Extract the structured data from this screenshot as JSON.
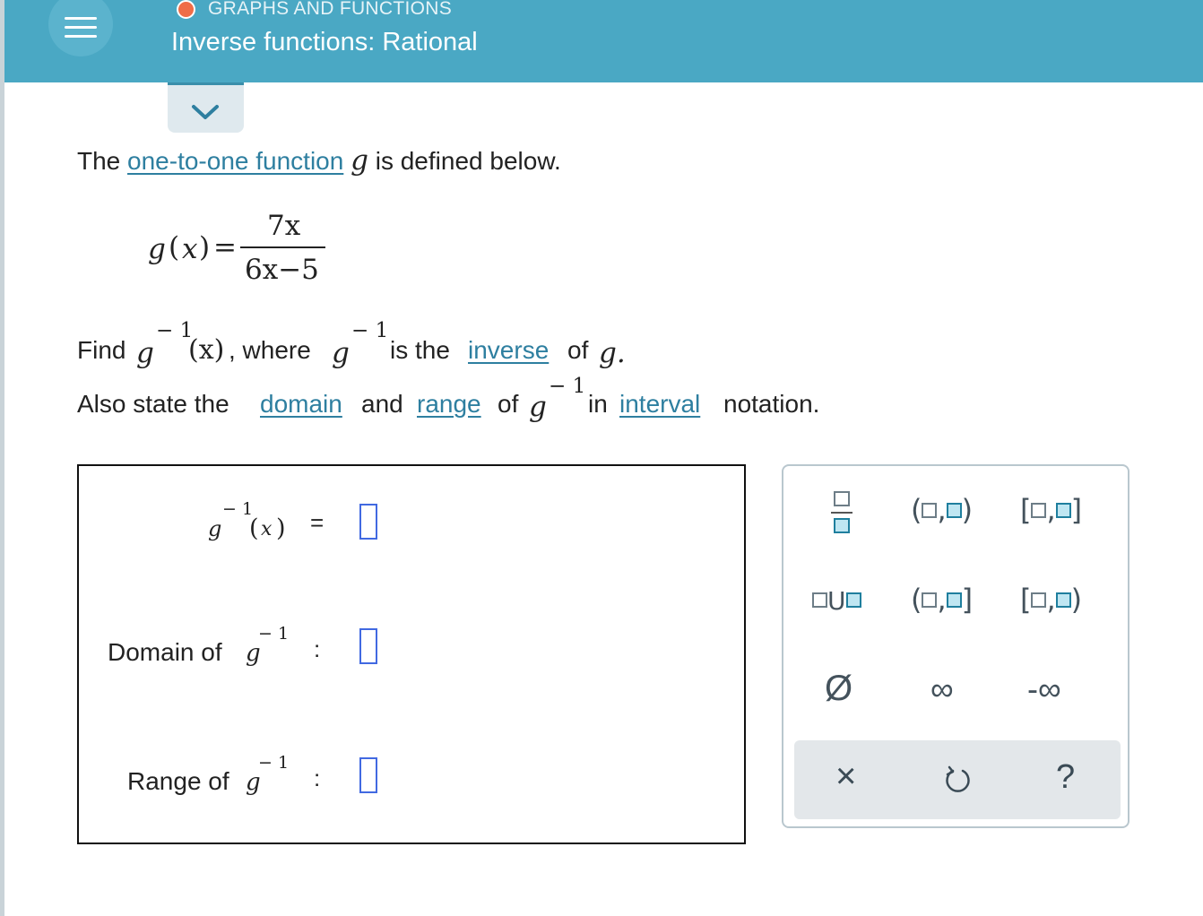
{
  "header": {
    "topic": "GRAPHS AND FUNCTIONS",
    "title": "Inverse functions: Rational",
    "colors": {
      "bar": "#4aa8c4",
      "topic_dot": "#ef6d48"
    }
  },
  "problem": {
    "line1_the": "The",
    "line1_link": "one-to-one function",
    "line1_var": "g",
    "line1_rest": "is defined below.",
    "formula": {
      "lhs": "g",
      "arg": "x",
      "eq": "=",
      "numerator": "7x",
      "denominator": "6x−5"
    },
    "line2_find": "Find",
    "line2_g1": "g",
    "line2_arg": "(x)",
    "line2_where": ", where",
    "line2_g2": "g",
    "line2_is_the": "is the",
    "line2_link": "inverse",
    "line2_of": "of",
    "line2_g3": "g.",
    "line3_also": "Also state the",
    "line3_link_domain": "domain",
    "line3_and": "and",
    "line3_link_range": "range",
    "line3_of": "of",
    "line3_g": "g",
    "line3_in": "in",
    "line3_link_interval": "interval",
    "line3_notation": "notation.",
    "exponent": "− 1"
  },
  "answer": {
    "row1": {
      "g": "g",
      "exp": "− 1",
      "arg": "(x)",
      "op": "="
    },
    "row2": {
      "label": "Domain of",
      "g": "g",
      "exp": "− 1",
      "op": ":"
    },
    "row3": {
      "label": "Range of",
      "g": "g",
      "exp": "− 1",
      "op": ":"
    },
    "blank_color": "#4169e1"
  },
  "keypad": {
    "open_open": [
      "(",
      ",",
      ")"
    ],
    "closed_closed": [
      "[",
      ",",
      "]"
    ],
    "union": "U",
    "open_closed": [
      "(",
      ",",
      "]"
    ],
    "closed_open": [
      "[",
      ",",
      ")"
    ],
    "empty_set": "Ø",
    "infinity": "∞",
    "neg_infinity": "-∞",
    "clear": "×",
    "undo": "↺",
    "help": "?",
    "icons": [
      "fraction-icon",
      "empty-set-icon",
      "close-icon",
      "undo-icon",
      "help-icon"
    ]
  }
}
